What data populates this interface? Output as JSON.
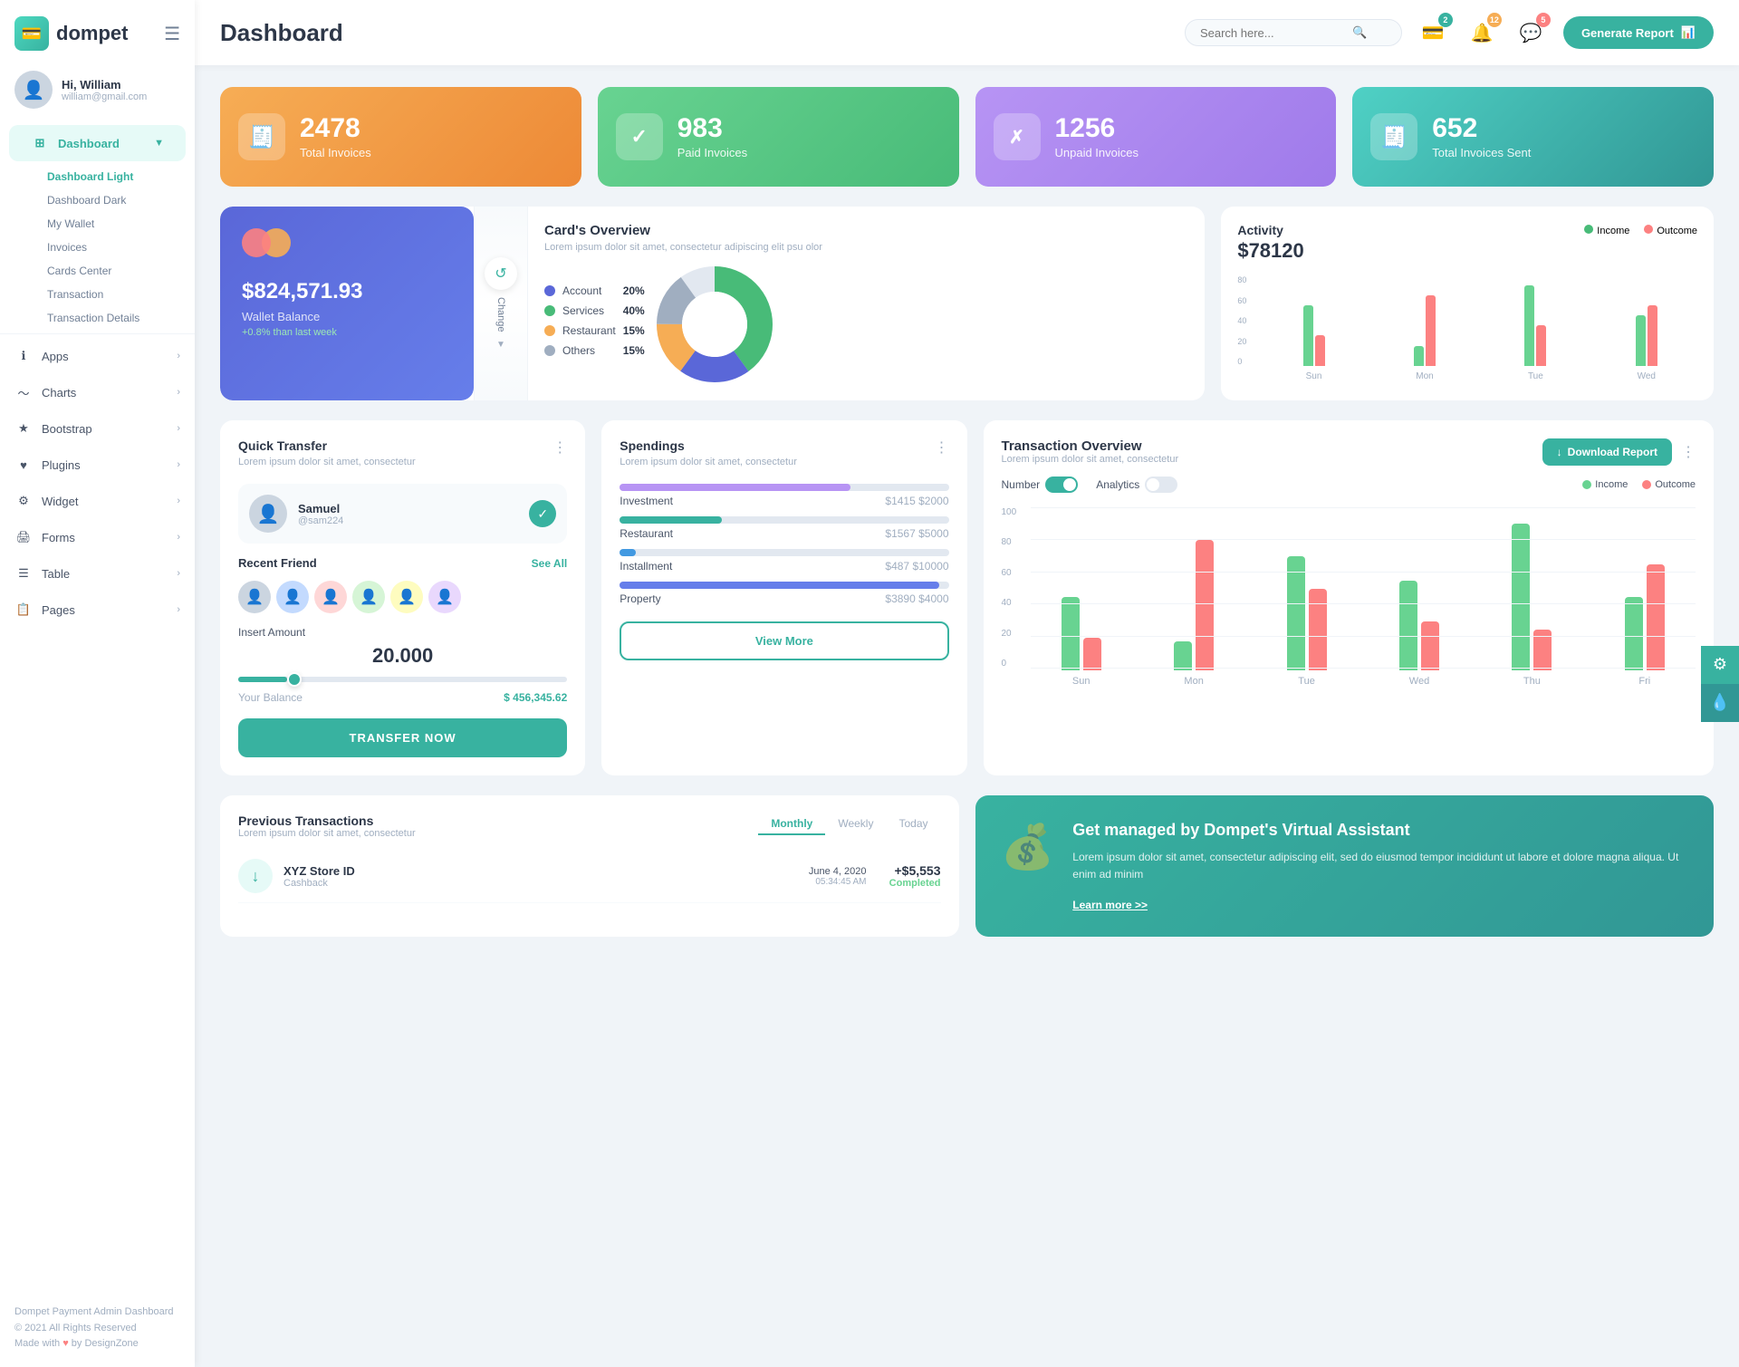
{
  "app": {
    "name": "dompet",
    "title": "Dashboard"
  },
  "sidebar": {
    "user": {
      "name": "Hi, William",
      "email": "william@gmail.com"
    },
    "nav": [
      {
        "id": "dashboard",
        "label": "Dashboard",
        "icon": "⊞",
        "active": true,
        "hasArrow": true
      },
      {
        "id": "apps",
        "label": "Apps",
        "icon": "ℹ",
        "hasArrow": true
      },
      {
        "id": "charts",
        "label": "Charts",
        "icon": "📈",
        "hasArrow": true
      },
      {
        "id": "bootstrap",
        "label": "Bootstrap",
        "icon": "★",
        "hasArrow": true
      },
      {
        "id": "plugins",
        "label": "Plugins",
        "icon": "♥",
        "hasArrow": true
      },
      {
        "id": "widget",
        "label": "Widget",
        "icon": "⚙",
        "hasArrow": true
      },
      {
        "id": "forms",
        "label": "Forms",
        "icon": "🖨",
        "hasArrow": true
      },
      {
        "id": "table",
        "label": "Table",
        "icon": "☰",
        "hasArrow": true
      },
      {
        "id": "pages",
        "label": "Pages",
        "icon": "🗒",
        "hasArrow": true
      }
    ],
    "submenu": [
      {
        "label": "Dashboard Light",
        "active": true
      },
      {
        "label": "Dashboard Dark",
        "active": false
      },
      {
        "label": "My Wallet",
        "active": false
      },
      {
        "label": "Invoices",
        "active": false
      },
      {
        "label": "Cards Center",
        "active": false
      },
      {
        "label": "Transaction",
        "active": false
      },
      {
        "label": "Transaction Details",
        "active": false
      }
    ],
    "footer": {
      "company": "Dompet Payment Admin Dashboard",
      "year": "© 2021 All Rights Reserved",
      "madeWith": "Made with ♥ by DesignZone"
    }
  },
  "topbar": {
    "search_placeholder": "Search here...",
    "badge_wallet": "2",
    "badge_notif": "12",
    "badge_msg": "5",
    "generate_btn": "Generate Report"
  },
  "stats": [
    {
      "id": "total-invoices",
      "number": "2478",
      "label": "Total Invoices",
      "color": "orange",
      "icon": "🧾"
    },
    {
      "id": "paid-invoices",
      "number": "983",
      "label": "Paid Invoices",
      "color": "green",
      "icon": "✓"
    },
    {
      "id": "unpaid-invoices",
      "number": "1256",
      "label": "Unpaid Invoices",
      "color": "purple",
      "icon": "✗"
    },
    {
      "id": "total-sent",
      "number": "652",
      "label": "Total Invoices Sent",
      "color": "teal",
      "icon": "🧾"
    }
  ],
  "wallet": {
    "amount": "$824,571.93",
    "label": "Wallet Balance",
    "change": "+0.8% than last week",
    "change_label": "Change"
  },
  "card_overview": {
    "title": "Card's Overview",
    "subtitle": "Lorem ipsum dolor sit amet, consectetur adipiscing elit psu olor",
    "categories": [
      {
        "name": "Account",
        "pct": "20%",
        "color": "#5a67d8"
      },
      {
        "name": "Services",
        "pct": "40%",
        "color": "#48bb78"
      },
      {
        "name": "Restaurant",
        "pct": "15%",
        "color": "#f6ad55"
      },
      {
        "name": "Others",
        "pct": "15%",
        "color": "#a0aec0"
      }
    ]
  },
  "activity": {
    "title": "Activity",
    "amount": "$78120",
    "legend_income": "Income",
    "legend_outcome": "Outcome",
    "bar_labels": [
      "Sun",
      "Mon",
      "Tue",
      "Wed"
    ],
    "bars": [
      {
        "green": 60,
        "red": 30
      },
      {
        "green": 20,
        "red": 70
      },
      {
        "green": 80,
        "red": 40
      },
      {
        "green": 50,
        "red": 60
      }
    ],
    "y_labels": [
      "80",
      "60",
      "40",
      "20",
      "0"
    ]
  },
  "quick_transfer": {
    "title": "Quick Transfer",
    "subtitle": "Lorem ipsum dolor sit amet, consectetur",
    "contact": {
      "name": "Samuel",
      "id": "@sam224"
    },
    "recent_friend_label": "Recent Friend",
    "see_all": "See All",
    "insert_amount_label": "Insert Amount",
    "amount": "20.000",
    "balance_label": "Your Balance",
    "balance": "$ 456,345.62",
    "transfer_btn": "TRANSFER NOW"
  },
  "spendings": {
    "title": "Spendings",
    "subtitle": "Lorem ipsum dolor sit amet, consectetur",
    "items": [
      {
        "name": "Investment",
        "current": "$1415",
        "max": "$2000",
        "pct": 70,
        "color": "#b794f4"
      },
      {
        "name": "Restaurant",
        "current": "$1567",
        "max": "$5000",
        "pct": 31,
        "color": "#38b2a0"
      },
      {
        "name": "Installment",
        "current": "$487",
        "max": "$10000",
        "pct": 5,
        "color": "#4299e1"
      },
      {
        "name": "Property",
        "current": "$3890",
        "max": "$4000",
        "pct": 97,
        "color": "#667eea"
      }
    ],
    "view_more_btn": "View More"
  },
  "transaction_overview": {
    "title": "Transaction Overview",
    "subtitle": "Lorem ipsum dolor sit amet, consectetur",
    "download_btn": "Download Report",
    "toggle_number": "Number",
    "toggle_analytics": "Analytics",
    "legend_income": "Income",
    "legend_outcome": "Outcome",
    "x_labels": [
      "Sun",
      "Mon",
      "Tue",
      "Wed",
      "Thu",
      "Fri"
    ],
    "bars": [
      {
        "g": 45,
        "r": 20
      },
      {
        "g": 18,
        "r": 80
      },
      {
        "g": 70,
        "r": 50
      },
      {
        "g": 55,
        "r": 30
      },
      {
        "g": 90,
        "r": 25
      },
      {
        "g": 45,
        "r": 65
      }
    ],
    "y_labels": [
      "100",
      "80",
      "60",
      "40",
      "20",
      "0"
    ]
  },
  "previous_transactions": {
    "title": "Previous Transactions",
    "subtitle": "Lorem ipsum dolor sit amet, consectetur",
    "tabs": [
      "Monthly",
      "Weekly",
      "Today"
    ],
    "active_tab": "Monthly",
    "transactions": [
      {
        "name": "XYZ Store ID",
        "type": "Cashback",
        "date": "June 4, 2020",
        "time": "05:34:45 AM",
        "amount": "+$5,553",
        "status": "Completed",
        "icon": "↓"
      }
    ]
  },
  "virtual_assistant": {
    "title": "Get managed by Dompet's Virtual Assistant",
    "text": "Lorem ipsum dolor sit amet, consectetur adipiscing elit, sed do eiusmod tempor incididunt ut labore et dolore magna aliqua. Ut enim ad minim",
    "link": "Learn more >>"
  }
}
